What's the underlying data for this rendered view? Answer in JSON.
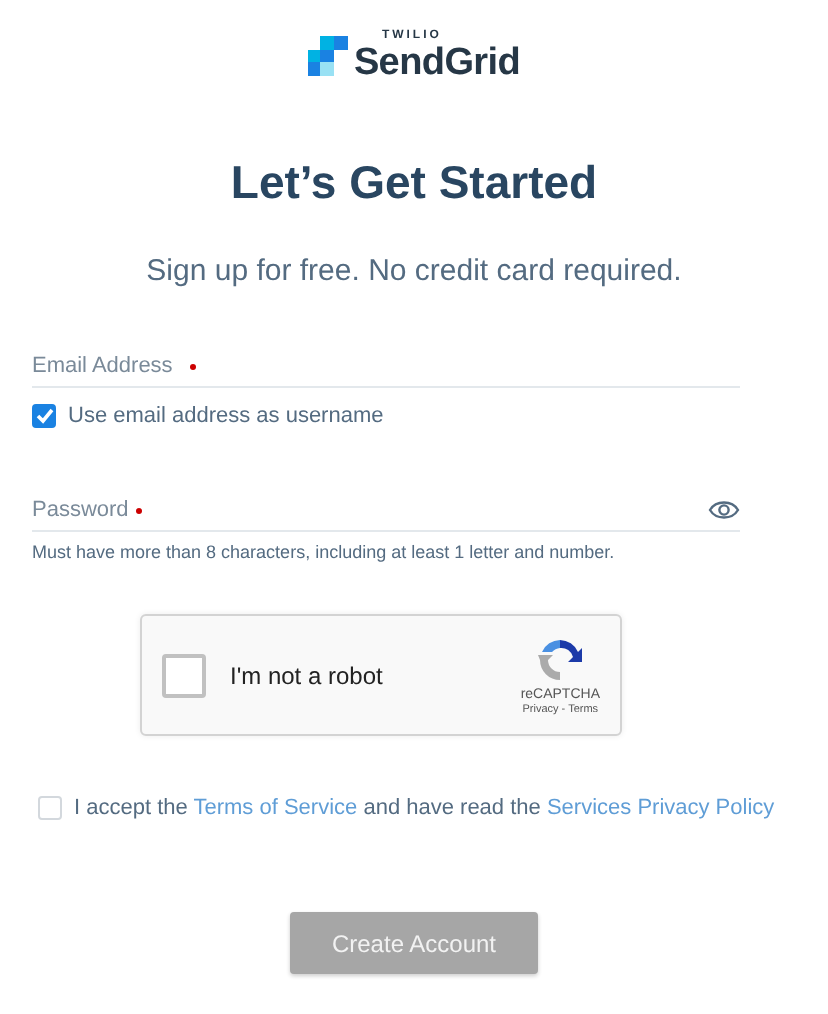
{
  "logo": {
    "overline": "TWILIO",
    "name": "SendGrid"
  },
  "title": "Let’s Get Started",
  "subtitle": "Sign up for free. No credit card required.",
  "email_field": {
    "placeholder": "Email Address",
    "required": true
  },
  "username_option": {
    "label": "Use email address as username",
    "checked": true
  },
  "password_field": {
    "placeholder": "Password",
    "required": true,
    "hint": "Must have more than 8 characters, including at least 1 letter and number."
  },
  "captcha": {
    "label": "I'm not a robot",
    "checked": false,
    "brand": "reCAPTCHA",
    "links": "Privacy - Terms"
  },
  "terms": {
    "checked": false,
    "parts": [
      {
        "kind": "text",
        "text": "I accept the "
      },
      {
        "kind": "link",
        "text": "Terms of Service"
      },
      {
        "kind": "text",
        "text": " and have read the "
      },
      {
        "kind": "link",
        "text": "Services Privacy Policy"
      }
    ]
  },
  "submit_button": {
    "label": "Create Account",
    "disabled": true
  }
}
